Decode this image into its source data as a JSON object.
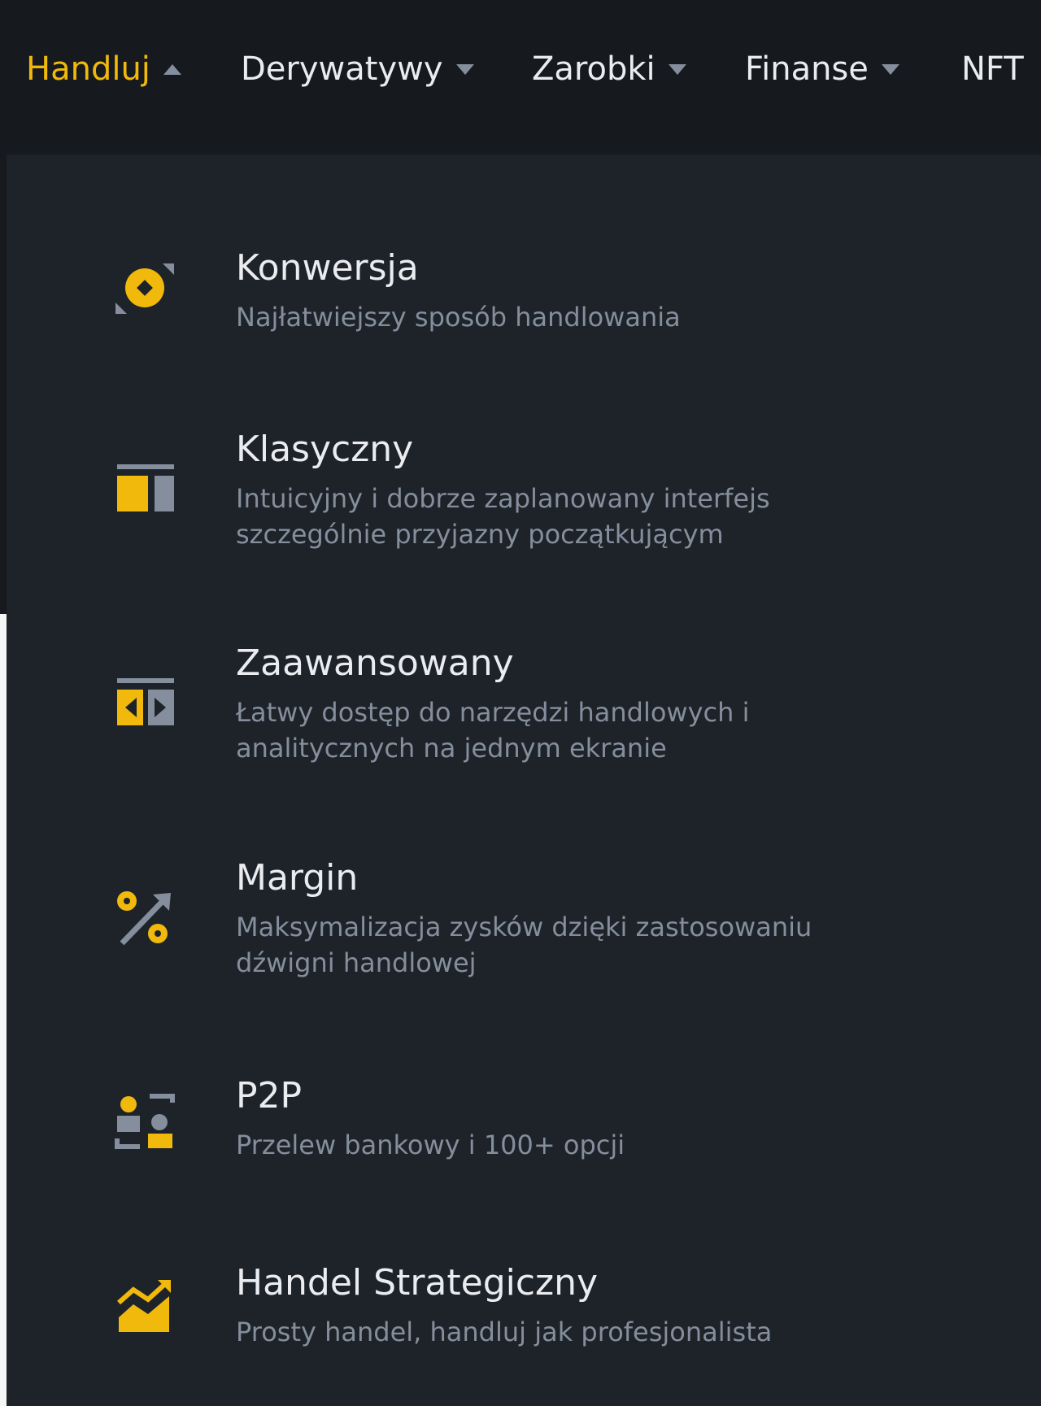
{
  "nav": {
    "items": [
      {
        "label": "Handluj",
        "active": true,
        "caret": "up"
      },
      {
        "label": "Derywatywy",
        "active": false,
        "caret": "down"
      },
      {
        "label": "Zarobki",
        "active": false,
        "caret": "down"
      },
      {
        "label": "Finanse",
        "active": false,
        "caret": "down"
      },
      {
        "label": "NFT",
        "active": false,
        "caret": "none"
      }
    ]
  },
  "menu": {
    "items": [
      {
        "title": "Konwersja",
        "description": "Najłatwiejszy sposób handlowania",
        "icon": "convert-icon"
      },
      {
        "title": "Klasyczny",
        "description": "Intuicyjny i dobrze zaplanowany interfejs szczególnie przyjazny początkującym",
        "icon": "classic-layout-icon"
      },
      {
        "title": "Zaawansowany",
        "description": "Łatwy dostęp do narzędzi handlowych i analitycznych na jednym ekranie",
        "icon": "advanced-layout-icon"
      },
      {
        "title": "Margin",
        "description": "Maksymalizacja zysków dzięki zastosowaniu dźwigni handlowej",
        "icon": "margin-percent-icon"
      },
      {
        "title": "P2P",
        "description": "Przelew bankowy i 100+ opcji",
        "icon": "p2p-users-icon"
      },
      {
        "title": "Handel Strategiczny",
        "description": "Prosty handel, handluj jak profesjonalista",
        "icon": "strategy-chart-icon"
      }
    ]
  },
  "colors": {
    "accent": "#f0b90b",
    "topbar": "#161a1e",
    "menu_bg": "#1e2329",
    "text_primary": "#eaecef",
    "text_secondary": "#848e9c"
  }
}
